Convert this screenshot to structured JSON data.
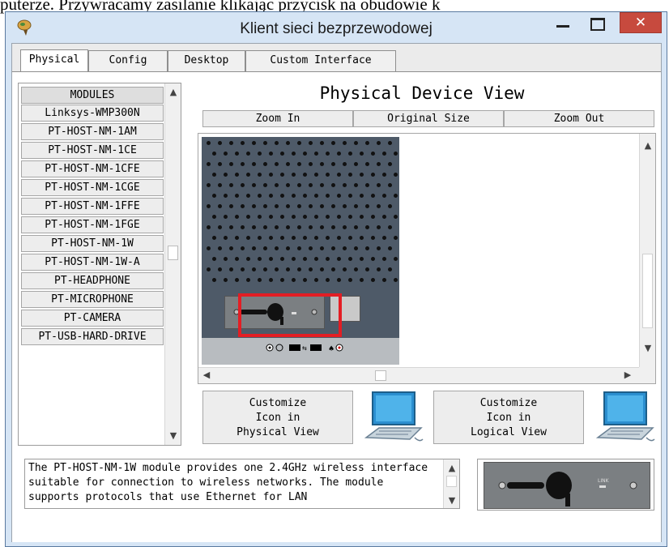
{
  "document_text": "puterze. Przywracamy zasilanie klikając przycisk na obudowie k",
  "window": {
    "title": "Klient sieci bezprzewodowej",
    "close_glyph": "✕"
  },
  "tabs": [
    {
      "label": "Physical",
      "active": true
    },
    {
      "label": "Config",
      "active": false
    },
    {
      "label": "Desktop",
      "active": false
    },
    {
      "label": "Custom Interface",
      "active": false
    }
  ],
  "modules": {
    "header": "MODULES",
    "items": [
      "Linksys-WMP300N",
      "PT-HOST-NM-1AM",
      "PT-HOST-NM-1CE",
      "PT-HOST-NM-1CFE",
      "PT-HOST-NM-1CGE",
      "PT-HOST-NM-1FFE",
      "PT-HOST-NM-1FGE",
      "PT-HOST-NM-1W",
      "PT-HOST-NM-1W-A",
      "PT-HEADPHONE",
      "PT-MICROPHONE",
      "PT-CAMERA",
      "PT-USB-HARD-DRIVE"
    ]
  },
  "physical_view": {
    "title": "Physical Device View",
    "zoom_in": "Zoom In",
    "original_size": "Original Size",
    "zoom_out": "Zoom Out"
  },
  "customize": {
    "physical_label": "Customize\nIcon in\nPhysical View",
    "logical_label": "Customize\nIcon in\nLogical View",
    "physical_lines": [
      "Customize",
      "Icon in",
      "Physical View"
    ],
    "logical_lines": [
      "Customize",
      "Icon in",
      "Logical View"
    ]
  },
  "description": "The PT-HOST-NM-1W module provides one 2.4GHz wireless interface suitable for connection to wireless networks. The module supports protocols that use Ethernet for LAN",
  "preview": {
    "link_label": "LINK"
  },
  "colors": {
    "highlight": "#e31e24",
    "close_button": "#c74a3e",
    "device_panel": "#4e5a68"
  }
}
